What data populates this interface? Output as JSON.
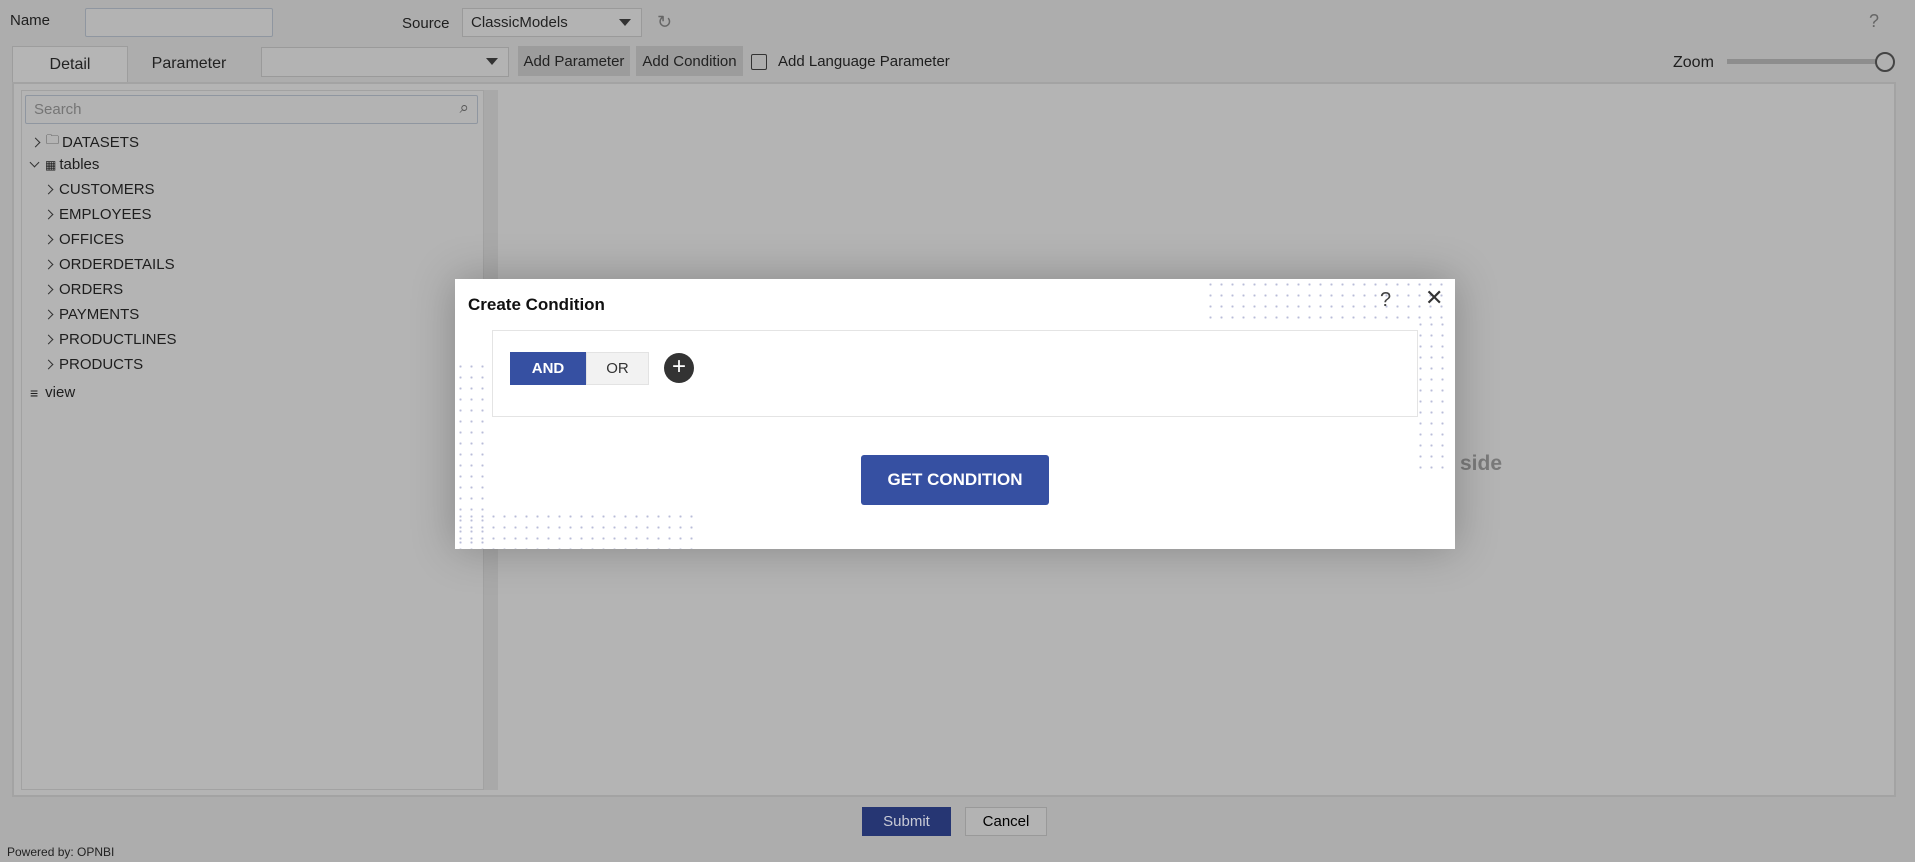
{
  "header": {
    "name_label": "Name",
    "name_value": "",
    "source_label": "Source",
    "source_value": "ClassicModels",
    "help": "?"
  },
  "toolbar": {
    "tabs": [
      {
        "label": "Detail",
        "active": true
      },
      {
        "label": "Parameter",
        "active": false
      }
    ],
    "parameter_select": "",
    "add_parameter": "Add Parameter",
    "add_condition": "Add Condition",
    "language_checkbox_label": "Add Language Parameter",
    "language_checked": false,
    "zoom_label": "Zoom",
    "zoom_level": 1.0
  },
  "sidebar": {
    "search_placeholder": "Search",
    "tree": {
      "datasets": "DATASETS",
      "tables": "tables",
      "table_items": [
        "CUSTOMERS",
        "EMPLOYEES",
        "OFFICES",
        "ORDERDETAILS",
        "ORDERS",
        "PAYMENTS",
        "PRODUCTLINES",
        "PRODUCTS"
      ],
      "view": "view"
    }
  },
  "canvas": {
    "hint_visible": "side"
  },
  "modal": {
    "title": "Create Condition",
    "help": "?",
    "and_label": "AND",
    "or_label": "OR",
    "selected": "AND",
    "get_condition": "GET CONDITION",
    "accent": "#3650a2"
  },
  "footer": {
    "submit": "Submit",
    "cancel": "Cancel",
    "powered_by": "Powered by: OPNBI"
  }
}
